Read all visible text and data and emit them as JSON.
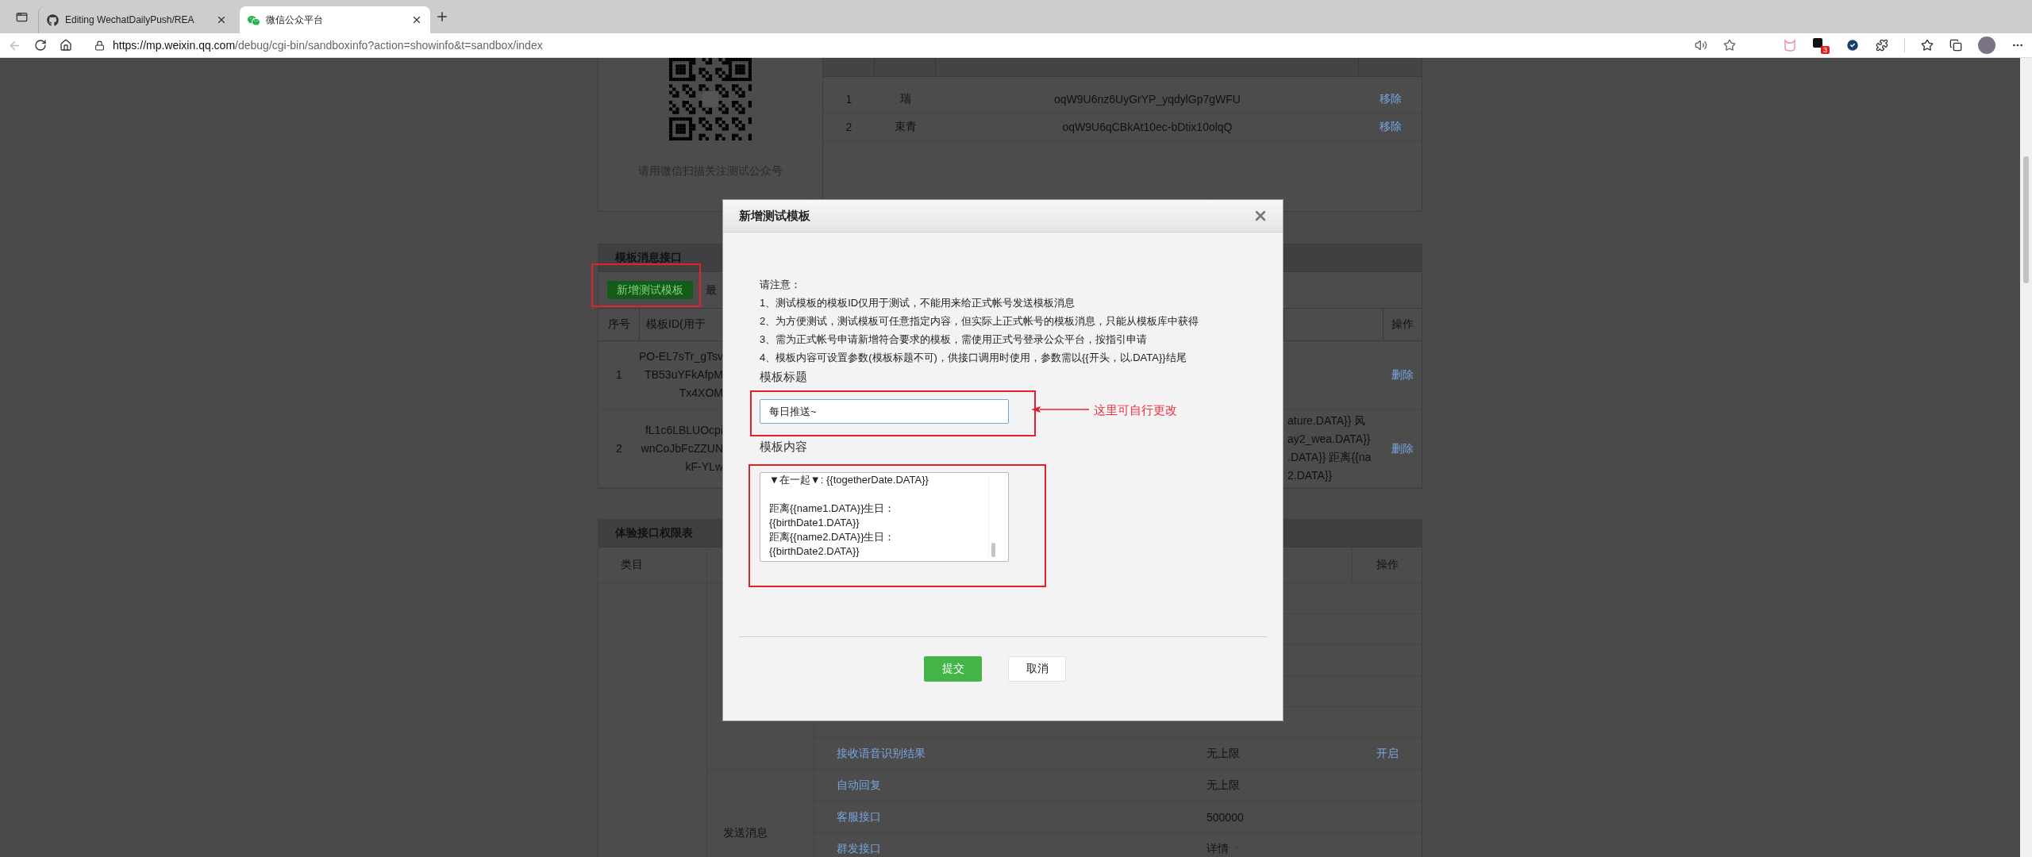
{
  "browser": {
    "tabs": [
      {
        "title": "Editing WechatDailyPush/REA",
        "selected": false,
        "kind": "github"
      },
      {
        "title": "微信公众平台",
        "selected": true,
        "kind": "wechat"
      }
    ],
    "url_host": "https://mp.weixin.qq.com",
    "url_path": "/debug/cgi-bin/sandboxinfo?action=showinfo&t=sandbox/index",
    "extension_badge": "3"
  },
  "test_account": {
    "qr_caption": "请用微信扫描关注测试公众号",
    "users": [
      {
        "index": "1",
        "nickname": "瑞",
        "openid": "oqW9U6nz6UyGrYP_yqdylGp7gWFU",
        "action": "移除"
      },
      {
        "index": "2",
        "nickname": "束青",
        "openid": "oqW9U6qCBkAt10ec-bDtix10olqQ",
        "action": "移除"
      }
    ]
  },
  "template_section": {
    "title": "模板消息接口",
    "add_button": "新增测试模板",
    "limit_note": "最",
    "columns": [
      "序号",
      "模板ID(用于"
    ],
    "action_column": "操作",
    "rows": [
      {
        "index": "1",
        "id_lines": [
          "PO-EL7sTr_gTsv",
          "TB53uYFkAfpM",
          "Tx4XOM"
        ],
        "content_lines": [],
        "action": "删除"
      },
      {
        "index": "2",
        "id_lines": [
          "fL1c6LBLUOcpi",
          "wnCoJbFcZZUN",
          "kF-YLw"
        ],
        "content_lines": [
          "ature.DATA}} 风",
          "ay2_wea.DATA}}",
          ".DATA}} 距离{{na",
          "2.DATA}}"
        ],
        "action": "删除"
      }
    ]
  },
  "permissions": {
    "title": "体验接口权限表",
    "category_column": "类目",
    "action_column": "操作",
    "group": "发送消息",
    "rows": [
      {
        "feature": "接收语音识别结果",
        "quota": "无上限",
        "action": "开启",
        "kind": "text"
      }
    ],
    "group_rows": [
      {
        "feature": "自动回复",
        "quota": "无上限",
        "kind": "text"
      },
      {
        "feature": "客服接口",
        "quota": "500000",
        "kind": "text"
      },
      {
        "feature": "群发接口",
        "quota": "详情",
        "kind": "dropdown"
      }
    ]
  },
  "dialog": {
    "title": "新增测试模板",
    "notice_heading": "请注意：",
    "notices": [
      "1、测试模板的模板ID仅用于测试，不能用来给正式帐号发送模板消息",
      "2、为方便测试，测试模板可任意指定内容，但实际上正式帐号的模板消息，只能从模板库中获得",
      "3、需为正式帐号申请新增符合要求的模板，需使用正式号登录公众平台，按指引申请",
      "4、模板内容可设置参数(模板标题不可)，供接口调用时使用，参数需以{{开头，以.DATA}}结尾"
    ],
    "title_label": "模板标题",
    "title_value": "每日推送~",
    "content_label": "模板内容",
    "content_value": "▼在一起▼: {{togetherDate.DATA}}\n\n距离{{name1.DATA}}生日：\n{{birthDate1.DATA}}\n距离{{name2.DATA}}生日：\n{{birthDate2.DATA}}",
    "submit": "提交",
    "cancel": "取消"
  },
  "annotation": {
    "note": "这里可自行更改"
  }
}
